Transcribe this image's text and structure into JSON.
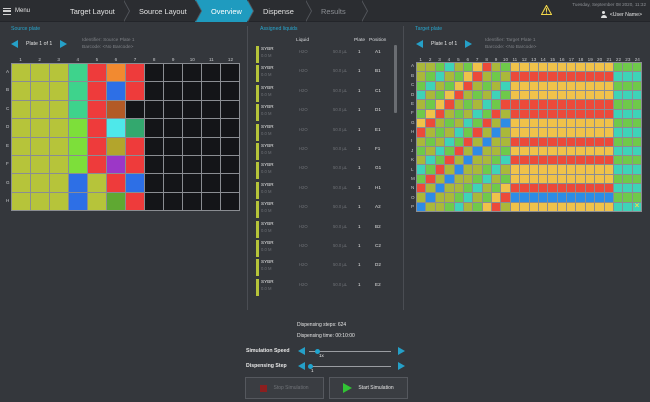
{
  "nav": {
    "menu_label": "Menu",
    "steps": [
      {
        "label": "Target Layout",
        "state": "normal"
      },
      {
        "label": "Source Layout",
        "state": "normal"
      },
      {
        "label": "Overview",
        "state": "active"
      },
      {
        "label": "Dispense",
        "state": "normal"
      },
      {
        "label": "Results",
        "state": "muted"
      }
    ],
    "datetime": "Tuesday, September 08 2020, 11:32",
    "user_name": "<User Name>"
  },
  "source": {
    "title": "Source plate",
    "plate_label": "Plate 1 of 1",
    "identifier": "Identifier: Source Plate 1",
    "barcode": "Barcode: <No Barcode>",
    "columns": [
      "1",
      "2",
      "3",
      "4",
      "5",
      "6",
      "7",
      "8",
      "9",
      "10",
      "11",
      "12"
    ],
    "rows": [
      "A",
      "B",
      "C",
      "D",
      "E",
      "F",
      "G",
      "H"
    ],
    "wells": [
      [
        "#b6c43a",
        "#b6c43a",
        "#b6c43a",
        "#3ed38c",
        "#ee3b3b",
        "#f28a30",
        "#ee3b3b",
        null,
        null,
        null,
        null,
        null
      ],
      [
        "#b6c43a",
        "#b6c43a",
        "#b6c43a",
        "#3ed38c",
        "#ee3b3b",
        "#2d6fe6",
        "#ee3b3b",
        null,
        null,
        null,
        null,
        null
      ],
      [
        "#b6c43a",
        "#b6c43a",
        "#b6c43a",
        "#3ed38c",
        "#ee3b3b",
        "#b35a26",
        null,
        null,
        null,
        null,
        null,
        null
      ],
      [
        "#b6c43a",
        "#b6c43a",
        "#b6c43a",
        "#7ddf3a",
        "#ee3b3b",
        "#4ee8ea",
        "#33a86e",
        null,
        null,
        null,
        null,
        null
      ],
      [
        "#b6c43a",
        "#b6c43a",
        "#b6c43a",
        "#7ddf3a",
        "#ee3b3b",
        "#b3a52c",
        "#ee3b3b",
        null,
        null,
        null,
        null,
        null
      ],
      [
        "#b6c43a",
        "#b6c43a",
        "#b6c43a",
        "#7ddf3a",
        "#ee3b3b",
        "#9c37c7",
        "#ee3b3b",
        null,
        null,
        null,
        null,
        null
      ],
      [
        "#b6c43a",
        "#b6c43a",
        "#b6c43a",
        "#2d6fe6",
        "#b6c43a",
        "#ee3b3b",
        "#2d6fe6",
        null,
        null,
        null,
        null,
        null
      ],
      [
        "#b6c43a",
        "#b6c43a",
        "#b6c43a",
        "#2d6fe6",
        "#b6c43a",
        "#5fa832",
        "#ee3b3b",
        null,
        null,
        null,
        null,
        null
      ]
    ]
  },
  "liquids": {
    "title": "Assigned liquids",
    "headers": {
      "liquid": "Liquid",
      "plate": "Plate",
      "position": "Position"
    },
    "items": [
      {
        "name": "SYBR",
        "sub": "0.0 M",
        "liquid": "H2O",
        "volume": "50.0 µL",
        "plate": "1",
        "position": "A1"
      },
      {
        "name": "SYBR",
        "sub": "0.0 M",
        "liquid": "H2O",
        "volume": "50.0 µL",
        "plate": "1",
        "position": "B1"
      },
      {
        "name": "SYBR",
        "sub": "0.0 M",
        "liquid": "H2O",
        "volume": "50.0 µL",
        "plate": "1",
        "position": "C1"
      },
      {
        "name": "SYBR",
        "sub": "0.0 M",
        "liquid": "H2O",
        "volume": "50.0 µL",
        "plate": "1",
        "position": "D1"
      },
      {
        "name": "SYBR",
        "sub": "0.0 M",
        "liquid": "H2O",
        "volume": "50.0 µL",
        "plate": "1",
        "position": "E1"
      },
      {
        "name": "SYBR",
        "sub": "0.0 M",
        "liquid": "H2O",
        "volume": "50.0 µL",
        "plate": "1",
        "position": "F1"
      },
      {
        "name": "SYBR",
        "sub": "0.0 M",
        "liquid": "H2O",
        "volume": "50.0 µL",
        "plate": "1",
        "position": "G1"
      },
      {
        "name": "SYBR",
        "sub": "0.0 M",
        "liquid": "H2O",
        "volume": "50.0 µL",
        "plate": "1",
        "position": "H1"
      },
      {
        "name": "SYBR",
        "sub": "0.0 M",
        "liquid": "H2O",
        "volume": "50.0 µL",
        "plate": "1",
        "position": "A2"
      },
      {
        "name": "SYBR",
        "sub": "0.0 M",
        "liquid": "H2O",
        "volume": "50.0 µL",
        "plate": "1",
        "position": "B2"
      },
      {
        "name": "SYBR",
        "sub": "0.0 M",
        "liquid": "H2O",
        "volume": "50.0 µL",
        "plate": "1",
        "position": "C2"
      },
      {
        "name": "SYBR",
        "sub": "0.0 M",
        "liquid": "H2O",
        "volume": "50.0 µL",
        "plate": "1",
        "position": "D2"
      },
      {
        "name": "SYBR",
        "sub": "0.0 M",
        "liquid": "H2O",
        "volume": "50.0 µL",
        "plate": "1",
        "position": "E2"
      }
    ]
  },
  "target": {
    "title": "Target plate",
    "plate_label": "Plate 1 of 1",
    "identifier": "Identifier: Target Plate 1",
    "barcode": "Barcode: <No Barcode>",
    "columns": [
      "1",
      "2",
      "3",
      "4",
      "5",
      "6",
      "7",
      "8",
      "9",
      "10",
      "11",
      "12",
      "13",
      "14",
      "15",
      "16",
      "17",
      "18",
      "19",
      "20",
      "21",
      "22",
      "23",
      "24"
    ],
    "rows": [
      "A",
      "B",
      "C",
      "D",
      "E",
      "F",
      "G",
      "H",
      "I",
      "J",
      "K",
      "L",
      "M",
      "N",
      "O",
      "P"
    ],
    "mark": "×",
    "palette": {
      "a": "#aab83a",
      "b": "#6fc94a",
      "c": "#3ed3b8",
      "d": "#f0c24a",
      "e": "#ec4a3a",
      "f": "#2d8ce6"
    }
  },
  "bottom": {
    "dispensing_steps": "Dispensing steps: 624",
    "dispensing_time": "Dispensing time: 00:10:00",
    "sim_speed_label": "Simulation Speed",
    "sim_speed_value": "1x",
    "sim_speed_level": 0.1,
    "disp_step_label": "Dispensing Step",
    "disp_step_value": "1",
    "disp_step_level": 0.02,
    "stop_label": "Stop Simulation",
    "start_label": "Start Simulation"
  },
  "colors": {
    "accent": "#1f9bbf",
    "warning": "#f2d74a"
  }
}
